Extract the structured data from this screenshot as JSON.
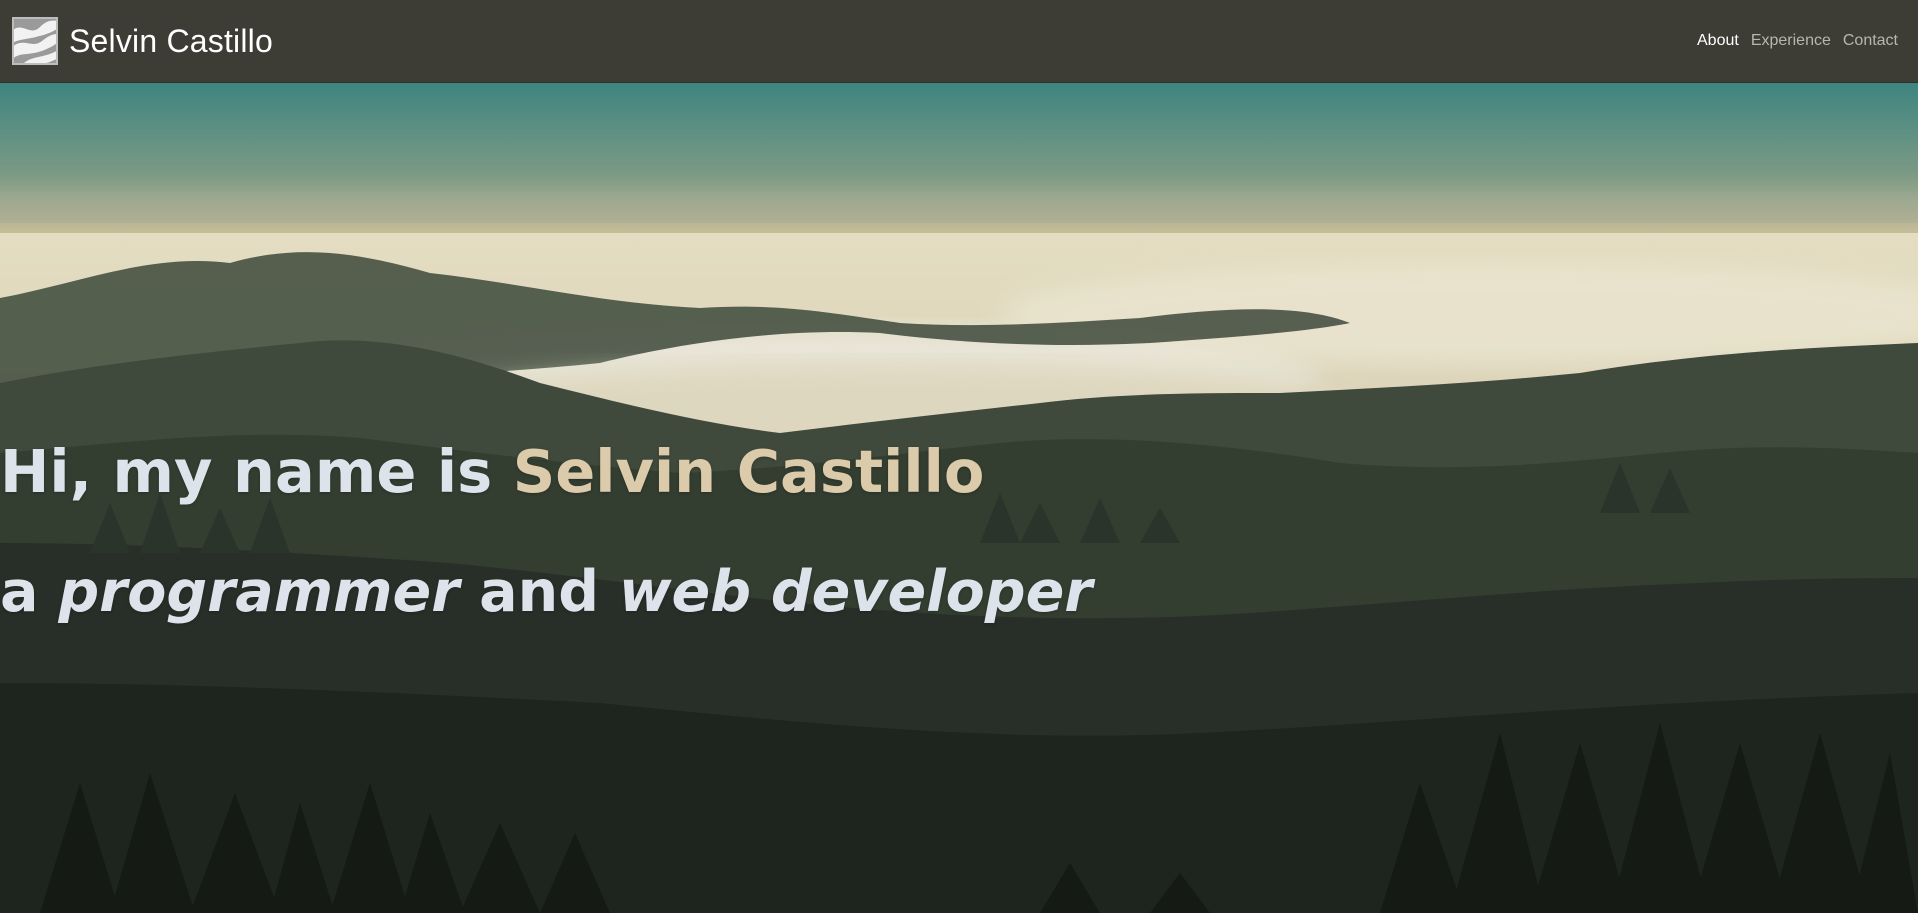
{
  "brand": {
    "name": "Selvin Castillo",
    "logo_icon": "abstract-waves-logo-icon"
  },
  "nav": {
    "items": [
      {
        "label": "About",
        "active": true
      },
      {
        "label": "Experience",
        "active": false
      },
      {
        "label": "Contact",
        "active": false
      }
    ]
  },
  "hero": {
    "intro": "Hi, my name is ",
    "name": "Selvin Castillo",
    "line2_prefix": "a ",
    "role1": "programmer",
    "connector": " and ",
    "role2": "web developer",
    "background": "foggy-forest-hills-photo"
  },
  "colors": {
    "navbar": "#3d3c35",
    "headline": "#dde3ea",
    "accent": "#dccbaa",
    "nav_link": "#b9b7aa",
    "nav_link_active": "#ffffff"
  }
}
